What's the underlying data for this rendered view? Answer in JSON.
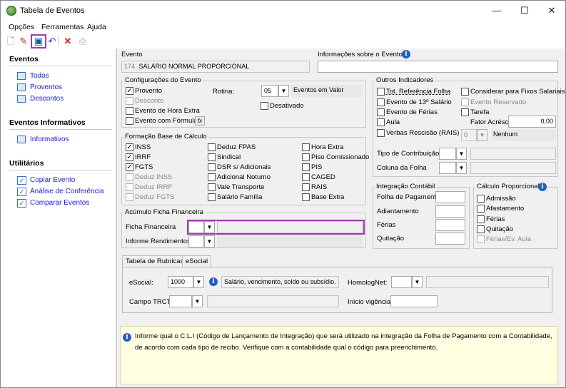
{
  "window": {
    "title": "Tabela de Eventos",
    "min": "—",
    "max": "☐",
    "close": "✕"
  },
  "menu": [
    "Opções",
    "Ferramentas",
    "Ajuda"
  ],
  "sidebar": {
    "eventos_title": "Eventos",
    "eventos": [
      "Todos",
      "Proventos",
      "Descontos"
    ],
    "informativos_title": "Eventos Informativos",
    "informativos": [
      "Informativos"
    ],
    "utilitarios_title": "Utilitários",
    "utilitarios": [
      "Copiar Evento",
      "Análise de Conferência",
      "Comparar Eventos"
    ]
  },
  "evento": {
    "label": "Evento",
    "code": "174",
    "name": "SALÁRIO NORMAL PROPORCIONAL",
    "info_label": "Informações sobre o Evento"
  },
  "config": {
    "title": "Configurações do Evento",
    "provento": "Provento",
    "desconto": "Desconto",
    "hora_extra": "Evento de Hora Extra",
    "formula": "Evento com Fórmula",
    "rotina_label": "Rotina:",
    "rotina_value": "05",
    "rotina_desc": "Eventos em Valor",
    "desativado": "Desativado",
    "fx": "fx"
  },
  "base": {
    "title": "Formação Base de Cálculo",
    "col1": [
      {
        "label": "INSS",
        "checked": true,
        "disabled": false
      },
      {
        "label": "IRRF",
        "checked": true,
        "disabled": false
      },
      {
        "label": "FGTS",
        "checked": true,
        "disabled": false
      },
      {
        "label": "Deduz INSS",
        "checked": false,
        "disabled": true
      },
      {
        "label": "Deduz IRRF",
        "checked": false,
        "disabled": true
      },
      {
        "label": "Deduz FGTS",
        "checked": false,
        "disabled": true
      }
    ],
    "col2": [
      "Deduz FPAS",
      "Sindical",
      "DSR s/ Adicionais",
      "Adicional Noturno",
      "Vale Transporte",
      "Salário Família"
    ],
    "col3": [
      "Hora Extra",
      "Piso Comissionado",
      "PIS",
      "CAGED",
      "RAIS",
      "Base Extra"
    ]
  },
  "acumulo": {
    "title": "Acúmulo Ficha Financeira",
    "ficha": "Ficha Financeira",
    "informe": "Informe Rendimentos"
  },
  "outros": {
    "title": "Outros Indicadores",
    "left": [
      "Tot. Referência Folha",
      "Evento de 13º Salário",
      "Evento de Férias",
      "Aula",
      "Verbas Rescisão (RAIS)"
    ],
    "right": [
      "Considerar para Fixos Salariais",
      "Evento Reservado",
      "Tarefa"
    ],
    "fator_label": "Fator Acréscimo",
    "fator_value": "0,00",
    "spin_value": "0",
    "nenhum": "Nenhum",
    "tipo_contrib": "Tipo de Contribuição",
    "coluna_folha": "Coluna da Folha"
  },
  "integracao": {
    "title": "Integração Contábil",
    "rows": [
      "Folha de Pagamento",
      "Adiantamento",
      "Férias",
      "Quitação"
    ]
  },
  "calculo": {
    "title": "Cálculo Proporcional",
    "rows": [
      "Admissão",
      "Afastamento",
      "Férias",
      "Quitação",
      "Férias/Ev. Aula"
    ]
  },
  "tabs": [
    "Tabela de Rubricas",
    "eSocial"
  ],
  "esocial": {
    "label": "eSocial:",
    "value": "1000",
    "desc": "Salário, vencimento, soldo ou subsídio.",
    "homolognet": "HomologNet:",
    "trct": "Campo TRCT:",
    "vigencia": "Início vigência:"
  },
  "hint": "Informe qual o C.L.I (Código de Lançamento de Integração) que será utilizado na integração da Folha de Pagamento com a Contabilidade, de acordo com cada tipo de recibo. Verifique com a contabilidade qual o código para preenchimento."
}
